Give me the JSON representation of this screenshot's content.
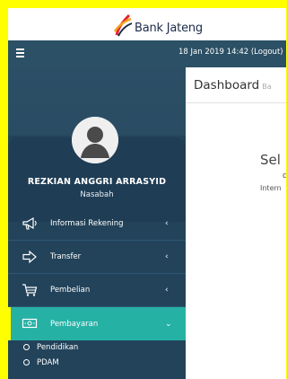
{
  "brand": {
    "name": "Bank Jateng"
  },
  "topbar": {
    "session": "18 Jan 2019 14:42 (Logout)",
    "menu_icon": "hamburger-icon"
  },
  "profile": {
    "name": "REZKIAN ANGGRI ARRASYID",
    "role": "Nasabah"
  },
  "menu": [
    {
      "label": "Informasi Rekening",
      "icon": "megaphone-icon",
      "chevron": "‹",
      "active": false
    },
    {
      "label": "Transfer",
      "icon": "arrow-right-icon",
      "chevron": "‹",
      "active": false
    },
    {
      "label": "Pembelian",
      "icon": "cart-icon",
      "chevron": "‹",
      "active": false
    },
    {
      "label": "Pembayaran",
      "icon": "money-icon",
      "chevron": "⌄",
      "active": true
    }
  ],
  "submenu": [
    {
      "label": "Pendidikan"
    },
    {
      "label": "PDAM"
    }
  ],
  "main": {
    "title": "Dashboard",
    "subtitle": "Ba"
  },
  "content": {
    "line1": "Sel",
    "line2": "d",
    "line3": "Intern"
  },
  "colors": {
    "topbar": "#2c5065",
    "sidebar": "#22435a",
    "active": "#26b1a5",
    "accent_bar": "#ffff00",
    "frame": "#ffff00"
  }
}
